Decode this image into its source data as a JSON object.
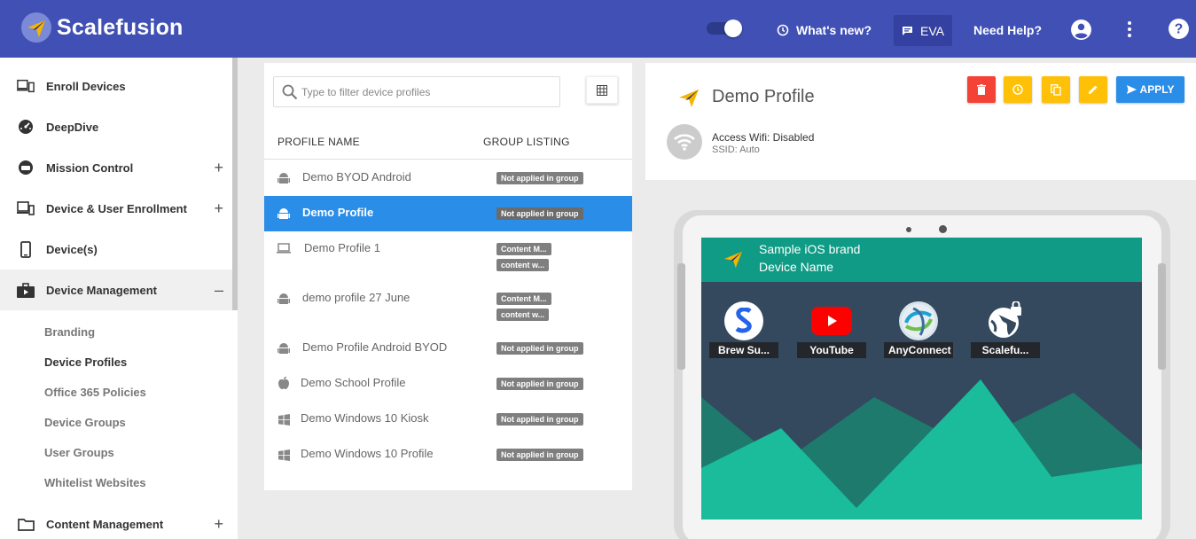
{
  "header": {
    "brand": "Scalefusion",
    "whats_new": "What's new?",
    "eva": "EVA",
    "need_help": "Need Help?"
  },
  "sidebar": {
    "items": [
      {
        "label": "Enroll Devices",
        "icon": "enroll-icon"
      },
      {
        "label": "DeepDive",
        "icon": "gauge-icon"
      },
      {
        "label": "Mission Control",
        "icon": "mission-icon",
        "expand": "+"
      },
      {
        "label": "Device & User Enrollment",
        "icon": "devices-icon",
        "expand": "+"
      },
      {
        "label": "Device(s)",
        "icon": "phone-icon"
      },
      {
        "label": "Device Management",
        "icon": "briefcase-icon",
        "expand": "–"
      },
      {
        "label": "Content Management",
        "icon": "folder-icon",
        "expand": "+"
      }
    ],
    "sub_items": [
      "Branding",
      "Device Profiles",
      "Office 365 Policies",
      "Device Groups",
      "User Groups",
      "Whitelist Websites"
    ]
  },
  "profiles": {
    "search_placeholder": "Type to filter device profiles",
    "col_name": "PROFILE NAME",
    "col_group": "GROUP LISTING",
    "rows": [
      {
        "name": "Demo BYOD Android",
        "os": "android",
        "badges": [
          "Not applied in group"
        ]
      },
      {
        "name": "Demo Profile",
        "os": "android",
        "badges": [
          "Not applied in group"
        ],
        "selected": true
      },
      {
        "name": "Demo Profile 1",
        "os": "laptop",
        "badges": [
          "Content M...",
          "content w..."
        ]
      },
      {
        "name": "demo profile 27 June",
        "os": "android",
        "badges": [
          "Content M...",
          "content w..."
        ]
      },
      {
        "name": "Demo Profile Android BYOD",
        "os": "android",
        "badges": [
          "Not applied in group"
        ]
      },
      {
        "name": "Demo School Profile",
        "os": "apple",
        "badges": [
          "Not applied in group"
        ]
      },
      {
        "name": "Demo Windows 10 Kiosk",
        "os": "windows",
        "badges": [
          "Not applied in group"
        ]
      },
      {
        "name": "Demo Windows 10 Profile",
        "os": "windows",
        "badges": [
          "Not applied in group"
        ]
      }
    ]
  },
  "detail": {
    "title": "Demo Profile",
    "apply_label": "APPLY",
    "wifi_status": "Access Wifi: Disabled",
    "ssid": "SSID: Auto",
    "colors": {
      "delete": "#f44336",
      "action": "#ffc107",
      "apply": "#2a8de8"
    }
  },
  "preview": {
    "brand_line1": "Sample iOS brand",
    "brand_line2": "Device Name",
    "apps": [
      {
        "label": "Brew Su..."
      },
      {
        "label": "YouTube"
      },
      {
        "label": "AnyConnect"
      },
      {
        "label": "Scalefu..."
      }
    ]
  }
}
